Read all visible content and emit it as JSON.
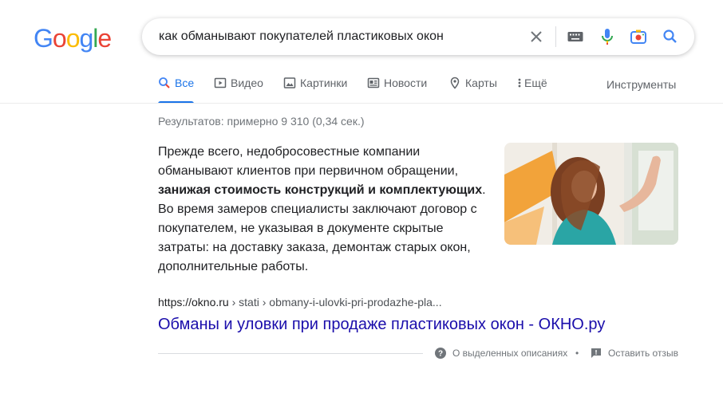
{
  "logo": {
    "letters": [
      "G",
      "o",
      "o",
      "g",
      "l",
      "e"
    ],
    "colors": [
      "#4285F4",
      "#EA4335",
      "#FBBC05",
      "#4285F4",
      "#34A853",
      "#EA4335"
    ]
  },
  "search": {
    "query": "как обманывают покупателей пластиковых окон"
  },
  "tabs": [
    {
      "label": "Все",
      "icon": "search-icon",
      "active": true
    },
    {
      "label": "Видео",
      "icon": "video-icon"
    },
    {
      "label": "Картинки",
      "icon": "image-icon"
    },
    {
      "label": "Новости",
      "icon": "news-icon"
    },
    {
      "label": "Карты",
      "icon": "location-pin-icon"
    },
    {
      "label": "Ещё",
      "icon": "more-vert-icon"
    }
  ],
  "tools_label": "Инструменты",
  "stats": "Результатов: примерно 9 310 (0,34 сек.)",
  "snippet": {
    "before": "Прежде всего, недобросовестные компании обманывают клиентов при первичном обращении, ",
    "bold": "занижая стоимость конструкций и комплектующих",
    "after": ". Во время замеров специалисты заключают договор с покупателем, не указывая в документе скрытые затраты: на доставку заказа, демонтаж старых окон, дополнительные работы."
  },
  "result": {
    "domain": "https://okno.ru",
    "path": " › stati › obmany-i-ulovki-pri-prodazhe-pla...",
    "title": "Обманы и уловки при продаже пластиковых окон - ОКНО.ру"
  },
  "footer": {
    "about": "О выделенных описаниях",
    "feedback": "Оставить отзыв",
    "separator": "•"
  },
  "colors": {
    "accent": "#1a73e8",
    "link": "#1a0dab"
  }
}
